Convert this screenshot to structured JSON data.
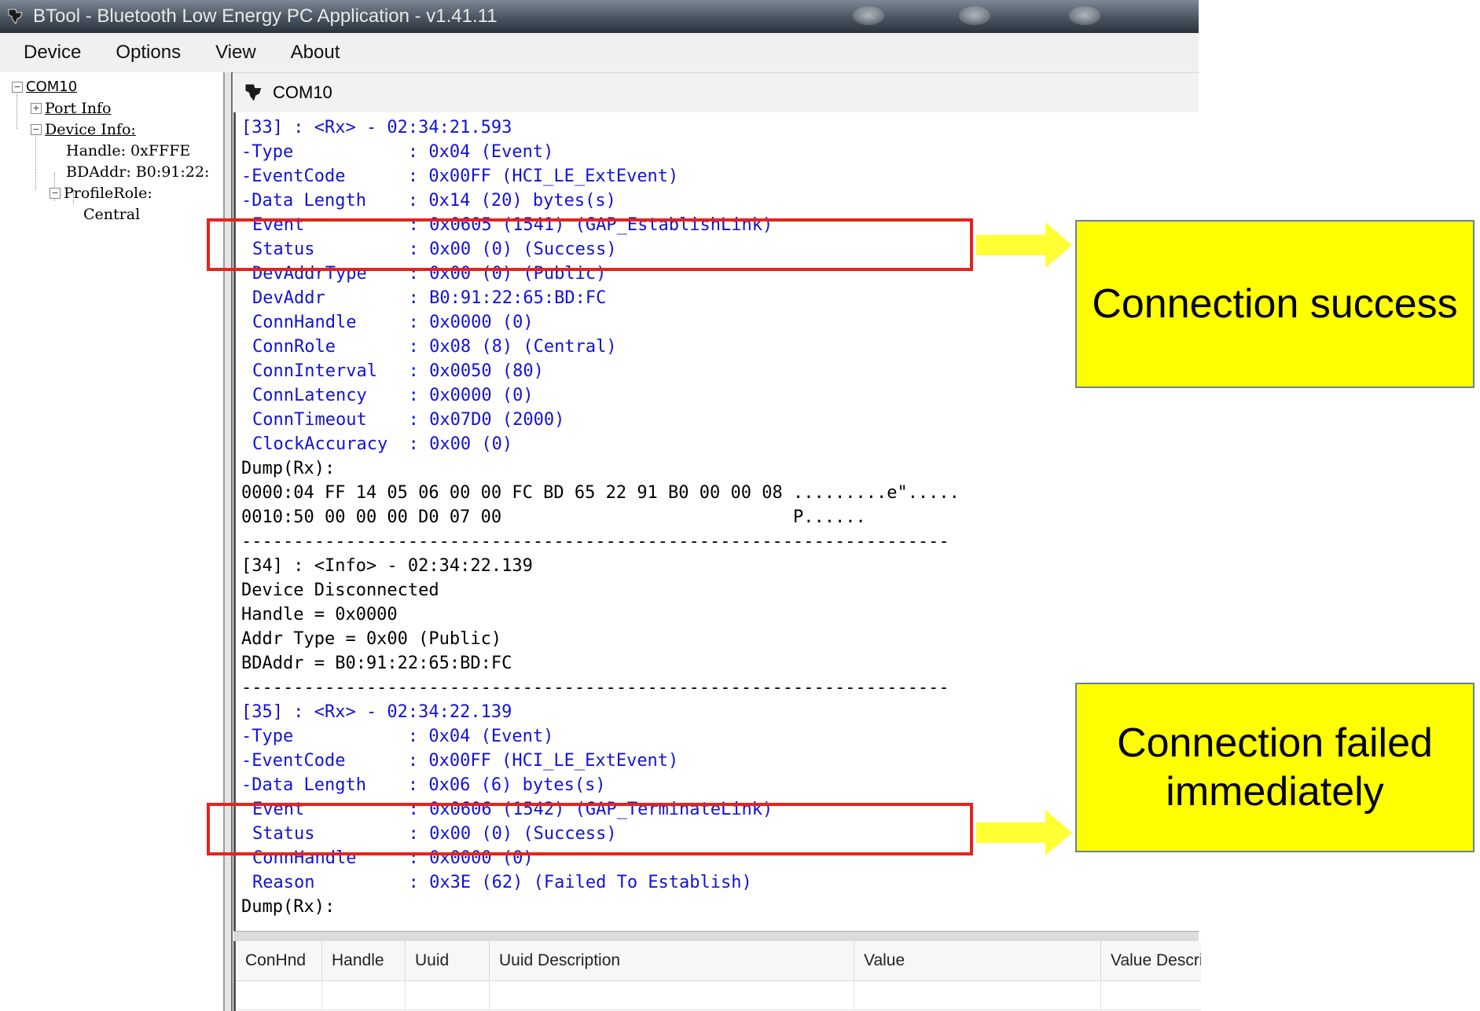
{
  "window": {
    "title": "BTool - Bluetooth Low Energy PC Application - v1.41.11"
  },
  "menu": [
    "Device",
    "Options",
    "View",
    "About"
  ],
  "tree": {
    "root": "COM10",
    "port_info": "Port Info",
    "device_info": "Device Info:",
    "handle": "Handle: 0xFFFE",
    "bdaddr": "BDAddr: B0:91:22:",
    "profile_role": "ProfileRole:",
    "role_value": "Central"
  },
  "tab": {
    "title": "COM10"
  },
  "log": [
    {
      "text": "[33] : <Rx> - 02:34:21.593",
      "style": "blue"
    },
    {
      "text": "-Type           : 0x04 (Event)",
      "style": "blue"
    },
    {
      "text": "-EventCode      : 0x00FF (HCI_LE_ExtEvent)",
      "style": "blue"
    },
    {
      "text": "-Data Length    : 0x14 (20) bytes(s)",
      "style": "blue"
    },
    {
      "text": "Event          : 0x0605 (1541) (GAP_EstablishLink)",
      "style": "blue ind"
    },
    {
      "text": "Status         : 0x00 (0) (Success)",
      "style": "blue ind"
    },
    {
      "text": "DevAddrType    : 0x00 (0) (Public)",
      "style": "blue ind"
    },
    {
      "text": "DevAddr        : B0:91:22:65:BD:FC",
      "style": "blue ind"
    },
    {
      "text": "ConnHandle     : 0x0000 (0)",
      "style": "blue ind"
    },
    {
      "text": "ConnRole       : 0x08 (8) (Central)",
      "style": "blue ind"
    },
    {
      "text": "ConnInterval   : 0x0050 (80)",
      "style": "blue ind"
    },
    {
      "text": "ConnLatency    : 0x0000 (0)",
      "style": "blue ind"
    },
    {
      "text": "ConnTimeout    : 0x07D0 (2000)",
      "style": "blue ind"
    },
    {
      "text": "ClockAccuracy  : 0x00 (0)",
      "style": "blue ind"
    },
    {
      "text": "Dump(Rx):",
      "style": "black"
    },
    {
      "text": "0000:04 FF 14 05 06 00 00 FC BD 65 22 91 B0 00 00 08 .........e\".....",
      "style": "black"
    },
    {
      "text": "0010:50 00 00 00 D0 07 00                            P......",
      "style": "black"
    },
    {
      "text": "--------------------------------------------------------------------",
      "style": "black"
    },
    {
      "text": "[34] : <Info> - 02:34:22.139",
      "style": "black"
    },
    {
      "text": "Device Disconnected",
      "style": "black"
    },
    {
      "text": "Handle = 0x0000",
      "style": "black"
    },
    {
      "text": "Addr Type = 0x00 (Public)",
      "style": "black"
    },
    {
      "text": "BDAddr = B0:91:22:65:BD:FC",
      "style": "black"
    },
    {
      "text": "--------------------------------------------------------------------",
      "style": "black"
    },
    {
      "text": "[35] : <Rx> - 02:34:22.139",
      "style": "blue"
    },
    {
      "text": "-Type           : 0x04 (Event)",
      "style": "blue"
    },
    {
      "text": "-EventCode      : 0x00FF (HCI_LE_ExtEvent)",
      "style": "blue"
    },
    {
      "text": "-Data Length    : 0x06 (6) bytes(s)",
      "style": "blue"
    },
    {
      "text": "Event          : 0x0606 (1542) (GAP_TerminateLink)",
      "style": "blue ind"
    },
    {
      "text": "Status         : 0x00 (0) (Success)",
      "style": "blue ind"
    },
    {
      "text": "ConnHandle     : 0x0000 (0)",
      "style": "blue ind"
    },
    {
      "text": "Reason         : 0x3E (62) (Failed To Establish)",
      "style": "blue ind"
    },
    {
      "text": "Dump(Rx):",
      "style": "black"
    }
  ],
  "grid": {
    "columns": [
      "ConHnd",
      "Handle",
      "Uuid",
      "Uuid Description",
      "Value",
      "Value Descri"
    ]
  },
  "annotations": {
    "callout_success": "Connection success",
    "callout_failed": "Connection failed immediately"
  },
  "colors": {
    "highlight_box": "#e5231d",
    "arrow": "#ffff33",
    "callout_bg": "#ffff00",
    "log_blue": "#1212d8"
  }
}
